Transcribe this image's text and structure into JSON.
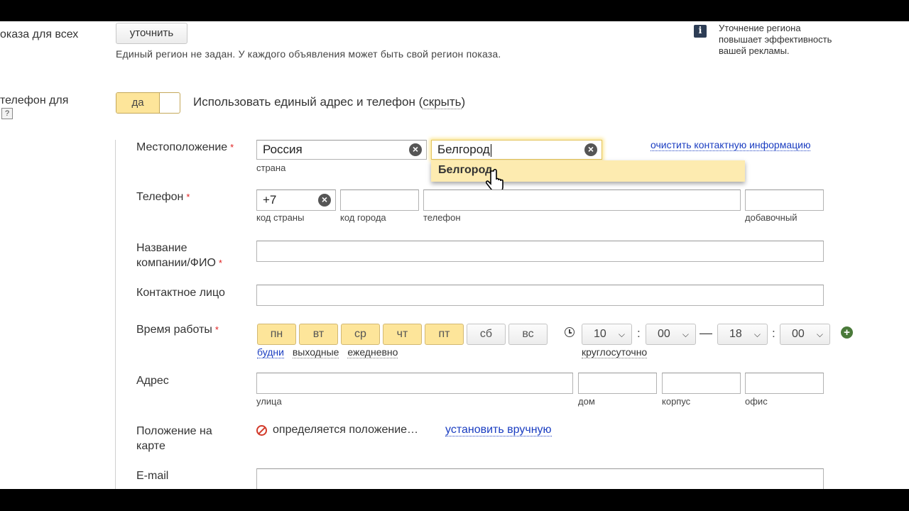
{
  "top": {
    "region_label": "оказа для всех",
    "refine_button": "уточнить",
    "region_note": "Единый регион не задан. У каждого объявления может быть свой регион показа.",
    "info_text": "Уточнение региона повышает эффективность вашей рекламы."
  },
  "phone_section": {
    "label": "телефон для",
    "help": "?",
    "toggle_on": "да",
    "desc_prefix": "Использовать единый адрес и телефон (",
    "hide_link": "скрыть",
    "desc_suffix": ")"
  },
  "form": {
    "location": {
      "label": "Местоположение",
      "country_value": "Россия",
      "country_caption": "страна",
      "city_value": "Белгород",
      "suggestion": "Белгород",
      "clear_contact_link": "очистить контактную информацию"
    },
    "phone": {
      "label": "Телефон",
      "country_code_value": "+7",
      "country_code_caption": "код страны",
      "city_code_caption": "код города",
      "number_caption": "телефон",
      "ext_caption": "добавочный"
    },
    "company": {
      "label_line1": "Название",
      "label_line2": "компании/ФИО"
    },
    "contact_person": {
      "label": "Контактное лицо"
    },
    "hours": {
      "label": "Время работы",
      "days": [
        "пн",
        "вт",
        "ср",
        "чт",
        "пт",
        "сб",
        "вс"
      ],
      "weekday_link": "будни",
      "weekend_link": "выходные",
      "daily_link": "ежедневно",
      "from_hour": "10",
      "from_min": "00",
      "dash": "—",
      "to_hour": "18",
      "to_min": "00",
      "colon": ":",
      "around_clock_link": "круглосуточно",
      "add_symbol": "+"
    },
    "address": {
      "label": "Адрес",
      "street_caption": "улица",
      "house_caption": "дом",
      "building_caption": "корпус",
      "office_caption": "офис"
    },
    "map": {
      "label_line1": "Положение на",
      "label_line2": "карте",
      "status": "определяется положение…",
      "manual_link": "установить вручную"
    },
    "email": {
      "label": "E-mail"
    },
    "required_mark": "*"
  },
  "colors": {
    "accent": "#fde59a",
    "link": "#1a3dc1",
    "required": "#e02020"
  }
}
